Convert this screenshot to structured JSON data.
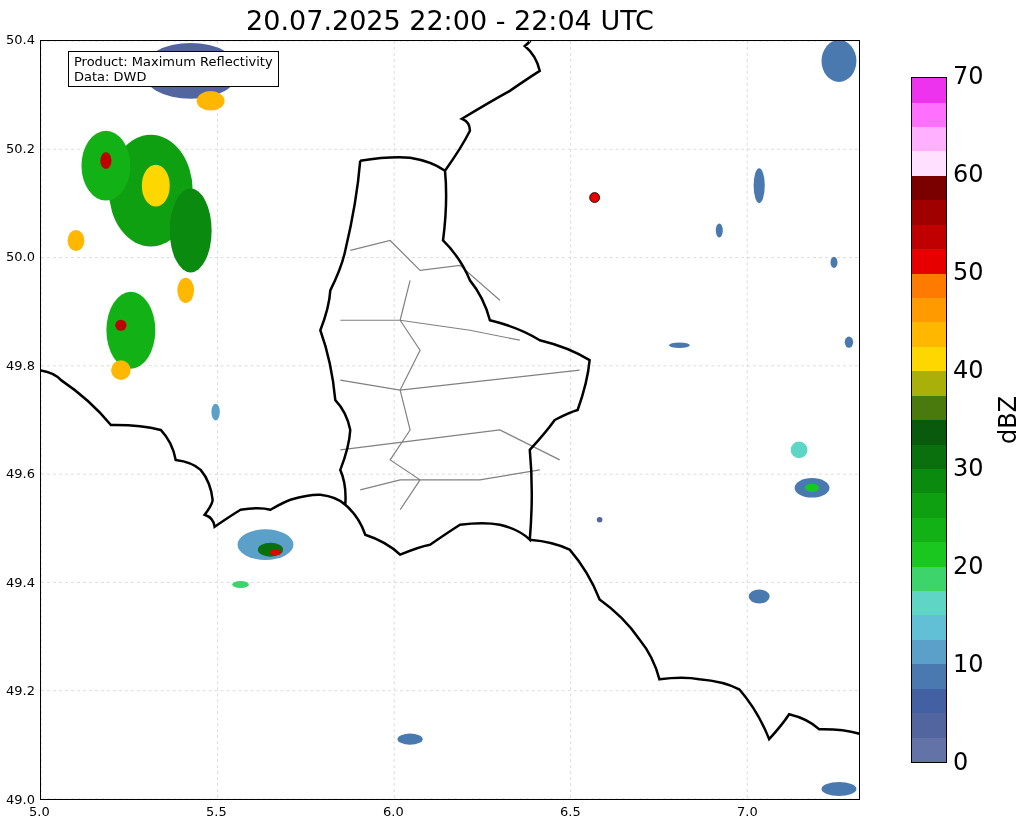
{
  "title": "20.07.2025 22:00 - 22:04 UTC",
  "legend": [
    "Product: Maximum Reflectivity",
    "Data: DWD"
  ],
  "x_axis": {
    "ticks": [
      "5.0",
      "5.5",
      "6.0",
      "6.5",
      "7.0"
    ]
  },
  "y_axis": {
    "ticks": [
      "50.4",
      "50.2",
      "50.0",
      "49.8",
      "49.6",
      "49.4",
      "49.2",
      "49.0"
    ]
  },
  "colorbar": {
    "label": "dBZ",
    "ticks": [
      "70",
      "60",
      "50",
      "40",
      "30",
      "20",
      "10",
      "0"
    ],
    "segments": [
      {
        "color": "#6373a8"
      },
      {
        "color": "#52659f"
      },
      {
        "color": "#4360a3"
      },
      {
        "color": "#4a79b0"
      },
      {
        "color": "#5ba0c9"
      },
      {
        "color": "#62c0d6"
      },
      {
        "color": "#5fd6c5"
      },
      {
        "color": "#3dd46c"
      },
      {
        "color": "#19c71f"
      },
      {
        "color": "#12b216"
      },
      {
        "color": "#0ea011"
      },
      {
        "color": "#0a8a0e"
      },
      {
        "color": "#0a700e"
      },
      {
        "color": "#0a5a0e"
      },
      {
        "color": "#4a7a0e"
      },
      {
        "color": "#aab00a"
      },
      {
        "color": "#ffd700"
      },
      {
        "color": "#ffb700"
      },
      {
        "color": "#ff9a00"
      },
      {
        "color": "#ff7a00"
      },
      {
        "color": "#e60000"
      },
      {
        "color": "#c00000"
      },
      {
        "color": "#a00000"
      },
      {
        "color": "#7a0000"
      },
      {
        "color": "#ffe0ff"
      },
      {
        "color": "#ffb0ff"
      },
      {
        "color": "#ff70ff"
      },
      {
        "color": "#ee33ee"
      }
    ]
  }
}
